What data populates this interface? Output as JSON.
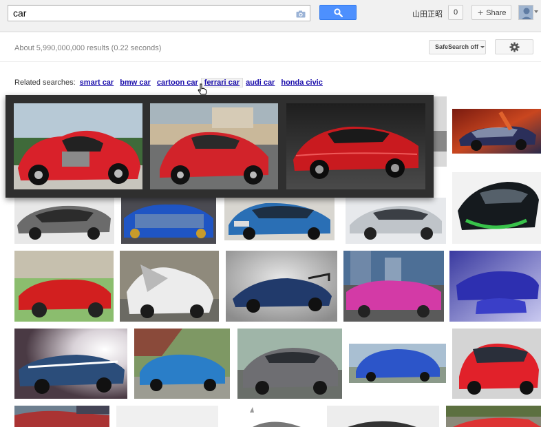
{
  "search": {
    "query": "car"
  },
  "header": {
    "user_name": "山田正昭",
    "notifications": "0",
    "share_label": "Share"
  },
  "results": {
    "stats": "About 5,990,000,000 results (0.22 seconds)"
  },
  "tools": {
    "safesearch_label": "SafeSearch off"
  },
  "related": {
    "label": "Related searches:",
    "items": [
      "smart car",
      "bmw car",
      "cartoon car",
      "ferrari car",
      "audi car",
      "honda civic"
    ],
    "active_index": 3
  },
  "colors": {
    "accent_blue": "#4d90fe",
    "link": "#1a0dab",
    "popup_bg": "#2f2f2f"
  }
}
